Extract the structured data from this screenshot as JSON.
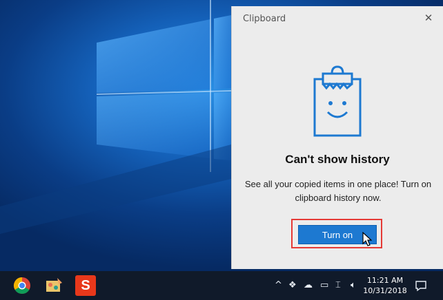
{
  "panel": {
    "title": "Clipboard",
    "close_icon": "close-icon",
    "heading": "Can't show history",
    "description": "See all your copied items in one place! Turn on clipboard history now.",
    "button_label": "Turn on",
    "illustration_icon": "clipboard-smile-icon",
    "accent_color": "#1d79d1",
    "highlight_color": "#e53935"
  },
  "taskbar": {
    "pinned": [
      {
        "name": "chrome-icon"
      },
      {
        "name": "paint-app-icon"
      },
      {
        "name": "snagit-icon"
      }
    ],
    "tray": {
      "icons": [
        "chevron-up-icon",
        "dropbox-icon",
        "onedrive-icon",
        "tablet-icon",
        "network-icon",
        "volume-icon"
      ],
      "time": "11:21 AM",
      "date": "10/31/2018",
      "notification_icon": "notification-icon"
    }
  }
}
